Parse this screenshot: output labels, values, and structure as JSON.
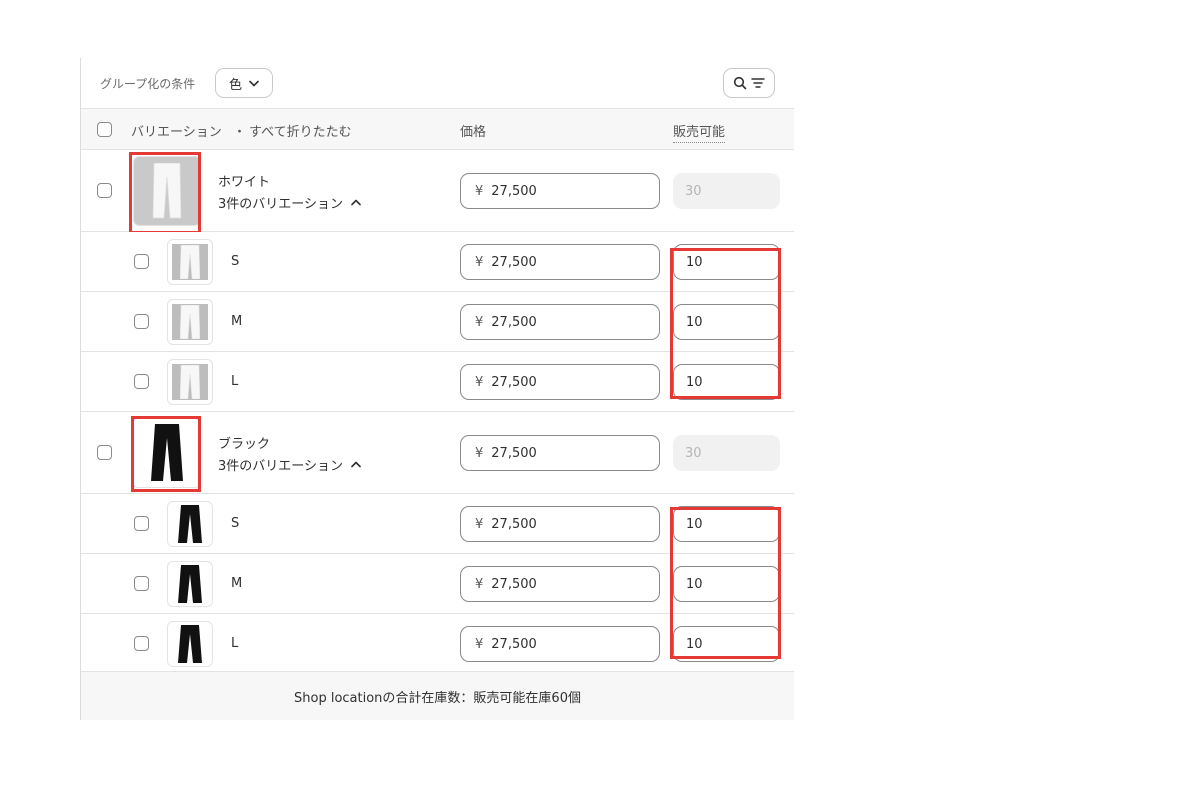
{
  "toolbar": {
    "group_by_label": "グループ化の条件",
    "group_by_value": "色"
  },
  "table": {
    "headers": {
      "variation": "バリエーション",
      "separator": "・",
      "collapse_all": "すべて折りたたむ",
      "price": "価格",
      "available": "販売可能"
    },
    "groups": [
      {
        "name": "ホワイト",
        "summary": "3件のバリエーション",
        "currency": "¥",
        "price": "27,500",
        "available": "30",
        "color": "#f4f4f4",
        "variants": [
          {
            "name": "S",
            "currency": "¥",
            "price": "27,500",
            "available": "10"
          },
          {
            "name": "M",
            "currency": "¥",
            "price": "27,500",
            "available": "10"
          },
          {
            "name": "L",
            "currency": "¥",
            "price": "27,500",
            "available": "10"
          }
        ]
      },
      {
        "name": "ブラック",
        "summary": "3件のバリエーション",
        "currency": "¥",
        "price": "27,500",
        "available": "30",
        "color": "#111111",
        "variants": [
          {
            "name": "S",
            "currency": "¥",
            "price": "27,500",
            "available": "10"
          },
          {
            "name": "M",
            "currency": "¥",
            "price": "27,500",
            "available": "10"
          },
          {
            "name": "L",
            "currency": "¥",
            "price": "27,500",
            "available": "10"
          }
        ]
      }
    ]
  },
  "footer": {
    "total_text": "Shop locationの合計在庫数：販売可能在庫60個"
  },
  "colors": {
    "highlight": "#e53935",
    "border": "#e3e3e3",
    "header_bg": "#f7f7f7"
  }
}
